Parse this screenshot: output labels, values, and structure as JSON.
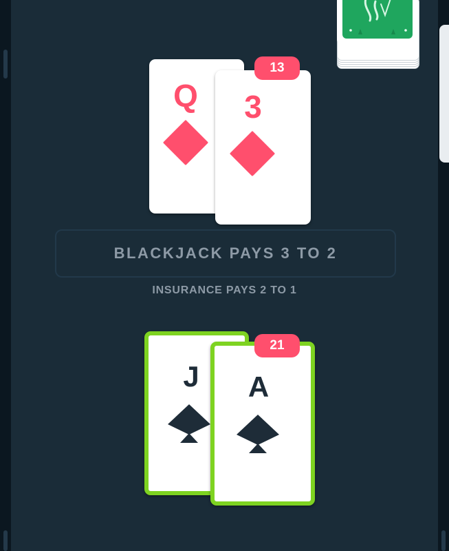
{
  "dealer": {
    "score": "13",
    "cards": [
      {
        "rank": "Q",
        "suit": "diamonds"
      },
      {
        "rank": "3",
        "suit": "diamonds"
      }
    ]
  },
  "player": {
    "score": "21",
    "cards": [
      {
        "rank": "J",
        "suit": "spades"
      },
      {
        "rank": "A",
        "suit": "spades"
      }
    ],
    "highlight_color": "#7ed321"
  },
  "rules": {
    "main": "BLACKJACK PAYS 3 TO 2",
    "sub": "INSURANCE PAYS 2 TO 1"
  },
  "deck": {
    "icon": "card-deck-icon",
    "back_color": "#1fa65e"
  },
  "colors": {
    "background": "#1a2c38",
    "badge": "#ff4f6d",
    "red_suit": "#ff4f6d",
    "black_suit": "#1e2c38"
  }
}
